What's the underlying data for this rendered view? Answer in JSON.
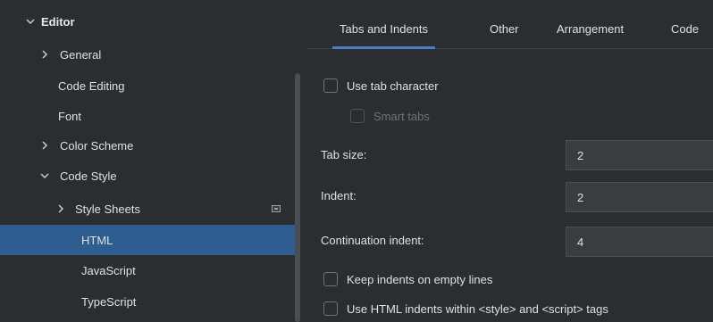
{
  "sidebar": {
    "items": [
      {
        "label": "Editor",
        "expanded": true
      },
      {
        "label": "General",
        "expanded": false
      },
      {
        "label": "Code Editing"
      },
      {
        "label": "Font"
      },
      {
        "label": "Color Scheme",
        "expanded": false
      },
      {
        "label": "Code Style",
        "expanded": true
      },
      {
        "label": "Style Sheets",
        "expanded": false,
        "icon": "page-icon"
      },
      {
        "label": "HTML",
        "selected": true
      },
      {
        "label": "JavaScript"
      },
      {
        "label": "TypeScript"
      }
    ]
  },
  "tabs": [
    {
      "label": "Tabs and Indents",
      "active": true
    },
    {
      "label": "Other"
    },
    {
      "label": "Arrangement"
    },
    {
      "label": "Code"
    }
  ],
  "options": {
    "use_tab_character": {
      "label": "Use tab character",
      "checked": false
    },
    "smart_tabs": {
      "label": "Smart tabs",
      "checked": false,
      "disabled": true
    },
    "keep_indents_empty": {
      "label": "Keep indents on empty lines",
      "checked": false
    },
    "use_html_indents": {
      "label": "Use HTML indents within <style> and <script> tags",
      "checked": false
    }
  },
  "fields": {
    "tab_size": {
      "label": "Tab size:",
      "value": "2"
    },
    "indent": {
      "label": "Indent:",
      "value": "2"
    },
    "continuation_indent": {
      "label": "Continuation indent:",
      "value": "4"
    }
  },
  "colors": {
    "background": "#2b2d30",
    "selection": "#2e5e8f",
    "accent": "#4a7fc1",
    "input_background": "#3a3c40"
  }
}
